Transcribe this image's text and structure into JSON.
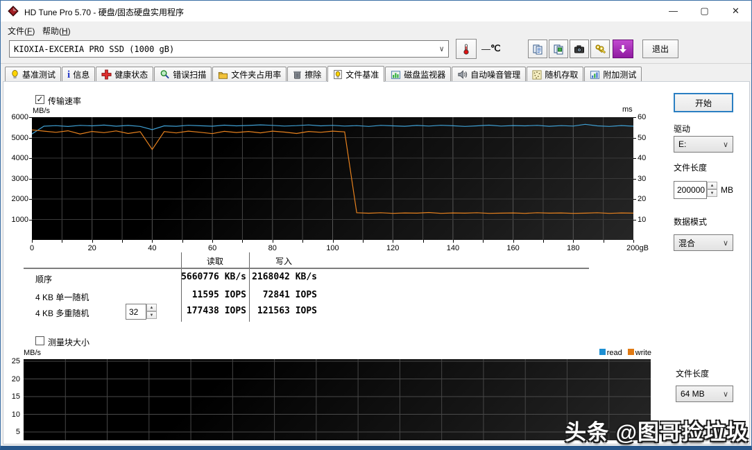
{
  "window": {
    "title": "HD Tune Pro 5.70 - 硬盘/固态硬盘实用程序",
    "temperature_value": "—",
    "temperature_unit": "℃"
  },
  "menu": {
    "file": {
      "pre": "文件(",
      "key": "F",
      "post": ")"
    },
    "help": {
      "pre": "帮助(",
      "key": "H",
      "post": ")"
    }
  },
  "toolbar": {
    "drive_selector_value": "KIOXIA-EXCERIA PRO SSD (1000 gB)",
    "exit_label": "退出",
    "icon_names": [
      "thermometer-icon",
      "copy-text-icon",
      "copy-image-icon",
      "camera-icon",
      "keys-icon",
      "save-report-icon"
    ]
  },
  "tabs": [
    {
      "label": "基准测试",
      "icon": "benchmark-icon",
      "active": false
    },
    {
      "label": "信息",
      "icon": "info-icon",
      "active": false
    },
    {
      "label": "健康状态",
      "icon": "health-icon",
      "active": false
    },
    {
      "label": "错误扫描",
      "icon": "error-scan-icon",
      "active": false
    },
    {
      "label": "文件夹占用率",
      "icon": "folder-usage-icon",
      "active": false
    },
    {
      "label": "擦除",
      "icon": "erase-icon",
      "active": false
    },
    {
      "label": "文件基准",
      "icon": "file-benchmark-icon",
      "active": true
    },
    {
      "label": "磁盘监视器",
      "icon": "disk-monitor-icon",
      "active": false
    },
    {
      "label": "自动噪音管理",
      "icon": "noise-management-icon",
      "active": false
    },
    {
      "label": "随机存取",
      "icon": "random-access-icon",
      "active": false
    },
    {
      "label": "附加测试",
      "icon": "extra-tests-icon",
      "active": false
    }
  ],
  "file_benchmark": {
    "transfer_rate_checkbox": {
      "label": "传输速率",
      "checked": true,
      "checkmark": "✓"
    },
    "block_size_checkbox": {
      "label": "测量块大小",
      "checked": false,
      "checkmark": ""
    },
    "table": {
      "col_headers": [
        "读取",
        "写入"
      ],
      "rows": [
        {
          "label": "顺序",
          "read": "5660776 KB/s",
          "write": "2168042 KB/s"
        },
        {
          "label": "4 KB 单一随机",
          "read": "11595 IOPS",
          "write": "72841 IOPS"
        },
        {
          "label": "4 KB 多重随机",
          "queue_depth": "32",
          "read": "177438 IOPS",
          "write": "121563 IOPS"
        }
      ]
    },
    "legend": [
      {
        "label": "read",
        "color": "#1d8fd2"
      },
      {
        "label": "write",
        "color": "#e07a14"
      }
    ]
  },
  "controls": {
    "start_button": "开始",
    "drive_label": "驱动",
    "drive_value": "E:",
    "file_length_label": "文件长度",
    "file_length_value": "200000",
    "file_length_unit": "MB",
    "data_mode_label": "数据模式",
    "data_mode_value": "混合",
    "file_length2_label": "文件长度",
    "file_length2_value": "64 MB"
  },
  "watermark": "头条 @图哥捡垃圾",
  "chart_data": [
    {
      "type": "line",
      "title": "传输速率",
      "xlabel_unit": "gB",
      "ylabel": "MB/s",
      "y2label": "ms",
      "xlim": [
        0,
        200
      ],
      "ylim": [
        0,
        6000
      ],
      "y2lim": [
        0,
        60
      ],
      "x_ticks": [
        0,
        20,
        40,
        60,
        80,
        100,
        120,
        140,
        160,
        180,
        200
      ],
      "x_minor_step": 10,
      "y_ticks": [
        1000,
        2000,
        3000,
        4000,
        5000,
        6000
      ],
      "y2_ticks": [
        10,
        20,
        30,
        40,
        50,
        60
      ],
      "grid": true,
      "series": [
        {
          "name": "read",
          "color": "#3fa0d4",
          "x_start": 0,
          "x_step": 4,
          "values": [
            5180,
            5560,
            5585,
            5545,
            5600,
            5575,
            5615,
            5560,
            5595,
            5550,
            5390,
            5575,
            5555,
            5605,
            5580,
            5560,
            5610,
            5575,
            5595,
            5625,
            5600,
            5565,
            5585,
            5620,
            5575,
            5600,
            5565,
            5585,
            5550,
            5600,
            5575,
            5555,
            5595,
            5565,
            5605,
            5580,
            5550,
            5575,
            5610,
            5565,
            5590,
            5575,
            5600,
            5555,
            5585,
            5565,
            5650,
            5575,
            5550,
            5590,
            5560
          ]
        },
        {
          "name": "write",
          "color": "#e8821e",
          "x_start": 0,
          "x_step": 4,
          "values": [
            5380,
            5320,
            5260,
            5335,
            5180,
            5300,
            5245,
            5330,
            5205,
            5290,
            4420,
            5295,
            5230,
            5320,
            5260,
            5195,
            5310,
            5250,
            5300,
            5235,
            5320,
            5270,
            5205,
            5300,
            5260,
            5320,
            5280,
            1330,
            1305,
            1330,
            1300,
            1320,
            1310,
            1340,
            1300,
            1320,
            1310,
            1330,
            1300,
            1310,
            1320,
            1300,
            1330,
            1310,
            1320,
            1300,
            1310,
            1330,
            1300,
            1320,
            1310
          ]
        }
      ]
    },
    {
      "type": "line",
      "title": "测量块大小",
      "ylabel": "MB/s",
      "ylim": [
        0,
        25.6
      ],
      "y_ticks": [
        5,
        10,
        15,
        20,
        25
      ],
      "x_gridline_count": 15,
      "grid": true,
      "legend": [
        "read",
        "write"
      ],
      "series": []
    }
  ]
}
